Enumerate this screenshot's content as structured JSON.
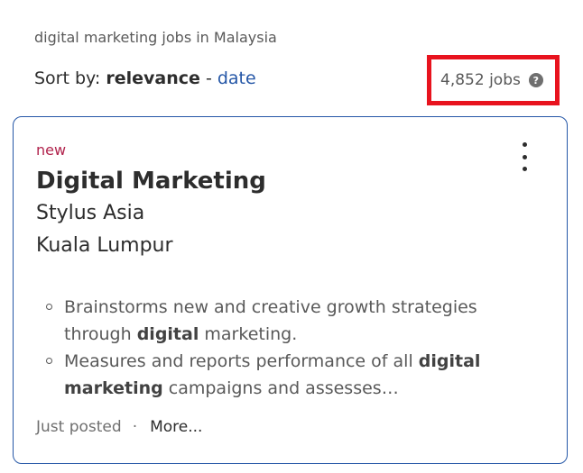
{
  "search": {
    "caption": "digital marketing jobs in Malaysia"
  },
  "sort": {
    "label": "Sort by: ",
    "active": "relevance",
    "separator": " - ",
    "alternate": "date"
  },
  "results": {
    "count_text": "4,852 jobs",
    "help_glyph": "?",
    "highlight_color": "#e8131e"
  },
  "job": {
    "badge": "new",
    "title": "Digital Marketing",
    "company": "Stylus Asia",
    "location": "Kuala Lumpur",
    "snippet": [
      {
        "before": "Brainstorms new and creative growth strategies through ",
        "bold": "digital",
        "after": " marketing."
      },
      {
        "before": "Measures and reports performance of all ",
        "bold": "digital marketing",
        "after": " campaigns and assesses…"
      }
    ],
    "posted": "Just posted",
    "dot": "·",
    "more": "More..."
  },
  "colors": {
    "accent": "#2557a7",
    "badge": "#b1244d"
  },
  "icons": {
    "menu": "kebab-menu-icon",
    "help": "question-circle-icon"
  }
}
